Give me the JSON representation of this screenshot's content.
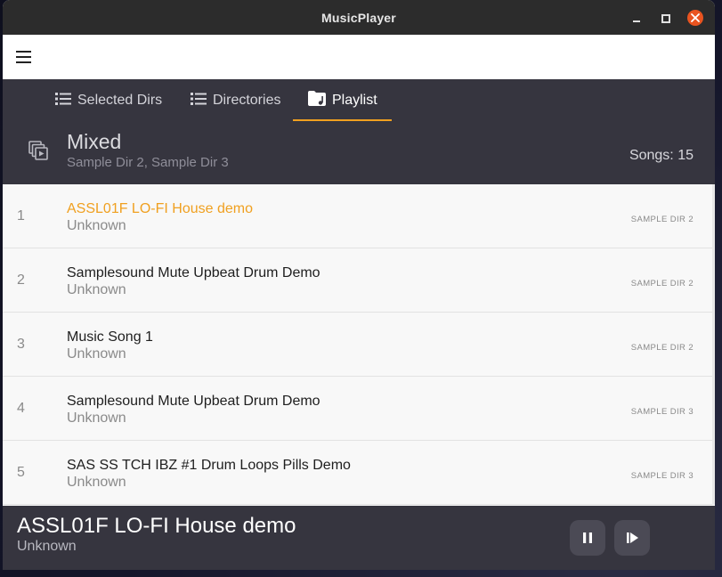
{
  "window": {
    "title": "MusicPlayer"
  },
  "tabs": [
    {
      "label": "Selected Dirs",
      "icon": "list-icon",
      "active": false
    },
    {
      "label": "Directories",
      "icon": "list-icon",
      "active": false
    },
    {
      "label": "Playlist",
      "icon": "folder-music-icon",
      "active": true
    }
  ],
  "playlist": {
    "icon": "playlist-stack-icon",
    "title": "Mixed",
    "subtitle": "Sample Dir 2, Sample Dir 3",
    "count_label": "Songs: 15"
  },
  "songs": [
    {
      "number": "1",
      "title": "ASSL01F LO-FI House demo",
      "artist": "Unknown",
      "dir": "SAMPLE DIR 2",
      "playing": true
    },
    {
      "number": "2",
      "title": "Samplesound Mute Upbeat Drum Demo",
      "artist": "Unknown",
      "dir": "SAMPLE DIR 2",
      "playing": false
    },
    {
      "number": "3",
      "title": "Music Song 1",
      "artist": "Unknown",
      "dir": "SAMPLE DIR 2",
      "playing": false
    },
    {
      "number": "4",
      "title": "Samplesound Mute Upbeat Drum Demo",
      "artist": "Unknown",
      "dir": "SAMPLE DIR 3",
      "playing": false
    },
    {
      "number": "5",
      "title": "SAS SS TCH IBZ #1 Drum Loops Pills Demo",
      "artist": "Unknown",
      "dir": "SAMPLE DIR 3",
      "playing": false
    }
  ],
  "now_playing": {
    "title": "ASSL01F LO-FI House demo",
    "artist": "Unknown"
  },
  "colors": {
    "accent": "#f0a020",
    "header_bg": "#36353f",
    "close_button": "#e95420"
  }
}
